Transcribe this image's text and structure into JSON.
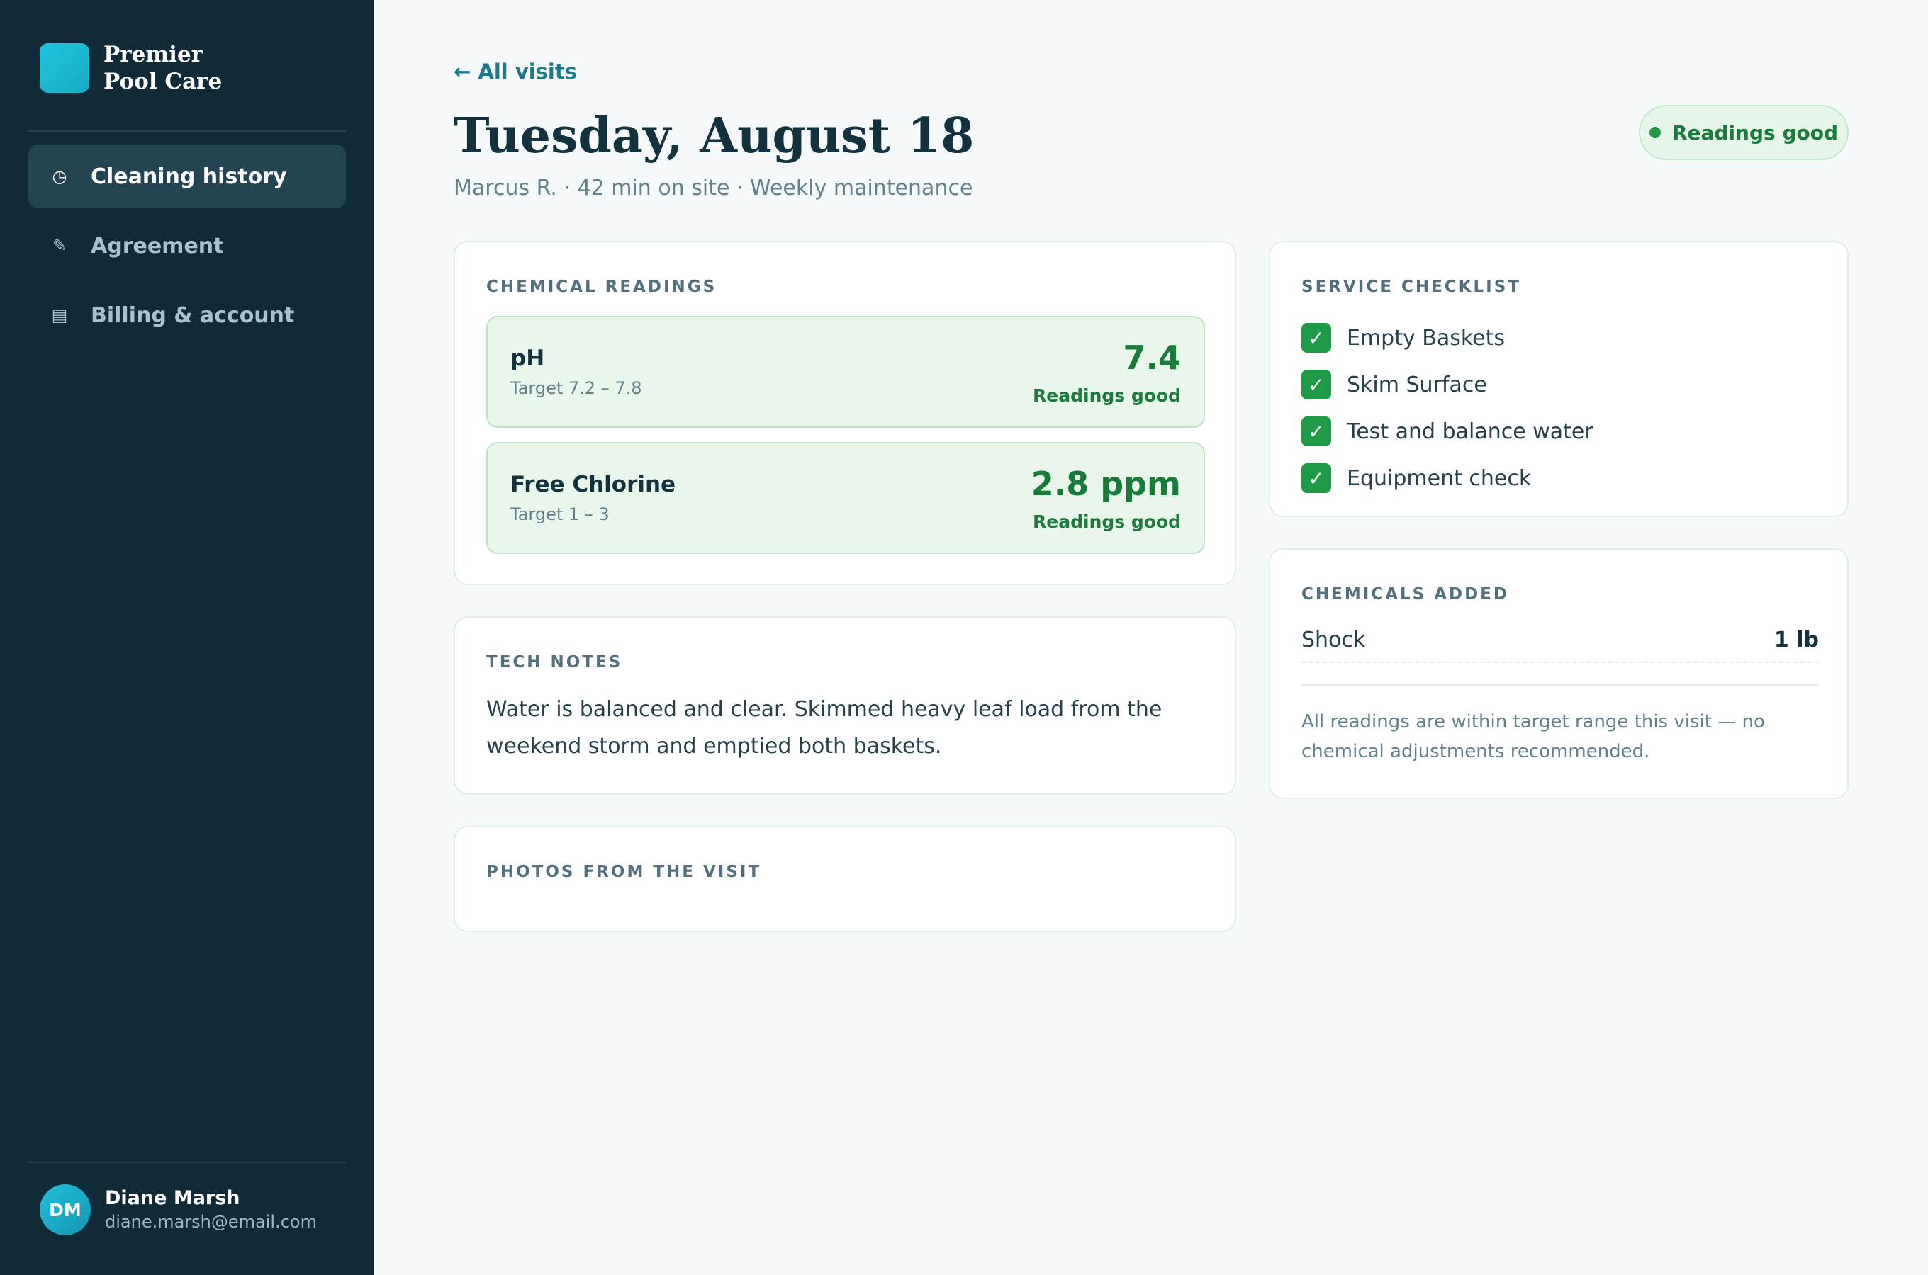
{
  "brand": {
    "name": "Premier Pool Care"
  },
  "nav": {
    "items": [
      {
        "label": "Cleaning history",
        "icon": "clock-icon",
        "glyph": "◷",
        "active": true
      },
      {
        "label": "Agreement",
        "icon": "pen-icon",
        "glyph": "✎",
        "active": false
      },
      {
        "label": "Billing & account",
        "icon": "billing-icon",
        "glyph": "▤",
        "active": false
      }
    ]
  },
  "user": {
    "initials": "DM",
    "name": "Diane Marsh",
    "email": "diane.marsh@email.com"
  },
  "header": {
    "back_label": "← All visits",
    "title": "Tuesday, August 18",
    "subtitle": "Marcus R. · 42 min on site · Weekly maintenance",
    "status": "Readings good"
  },
  "chemical_readings": {
    "label": "Chemical readings",
    "items": [
      {
        "name": "pH",
        "target": "Target 7.2 – 7.8",
        "value": "7.4",
        "status": "Readings good"
      },
      {
        "name": "Free Chlorine",
        "target": "Target 1 – 3",
        "value": "2.8 ppm",
        "status": "Readings good"
      }
    ]
  },
  "tech_notes": {
    "label": "Tech notes",
    "text": "Water is balanced and clear. Skimmed heavy leaf load from the weekend storm and emptied both baskets."
  },
  "photos": {
    "label": "Photos from the visit"
  },
  "checklist": {
    "label": "Service checklist",
    "items": [
      {
        "label": "Empty Baskets",
        "checked": true
      },
      {
        "label": "Skim Surface",
        "checked": true
      },
      {
        "label": "Test and balance water",
        "checked": true
      },
      {
        "label": "Equipment check",
        "checked": true
      }
    ]
  },
  "chemicals_added": {
    "label": "Chemicals added",
    "items": [
      {
        "name": "Shock",
        "amount": "1 lb"
      }
    ],
    "note": "All readings are within target range this visit — no chemical adjustments recommended."
  },
  "colors": {
    "sidebar": "#112a37",
    "accent": "#1a7a8c",
    "good": "#1f9a47",
    "good_bg": "#e9f6ec"
  }
}
